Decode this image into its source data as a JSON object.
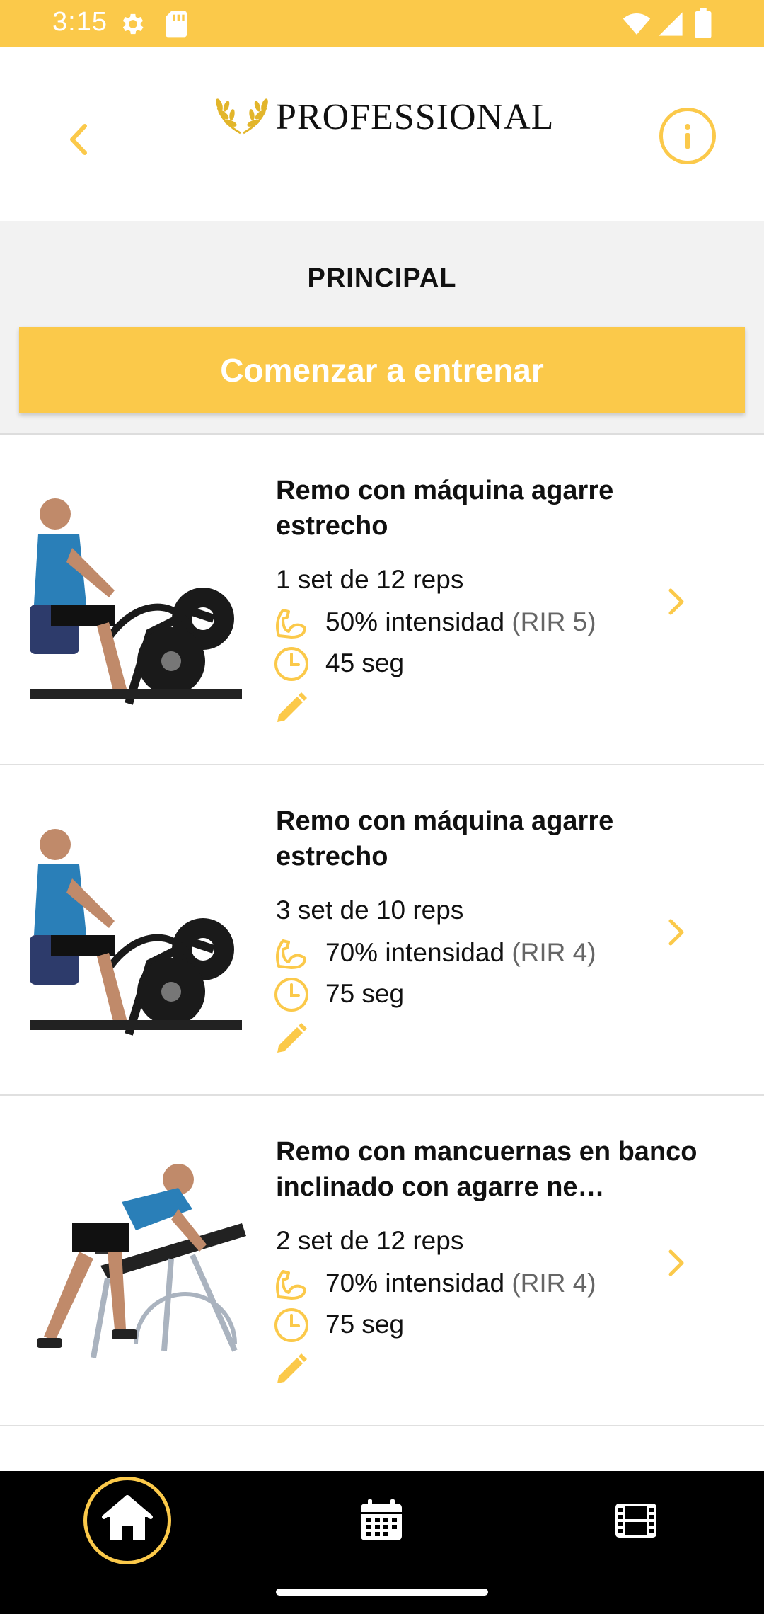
{
  "status_bar": {
    "time": "3:15",
    "background": "#FBC94A"
  },
  "header": {
    "logo_text": "PROFESSIONAL",
    "back_icon": "chevron-left-icon",
    "info_icon": "info-icon",
    "accent": "#FBC94A"
  },
  "section": {
    "title": "PRINCIPAL",
    "start_button": "Comenzar a entrenar"
  },
  "exercises": [
    {
      "title": "Remo con máquina agarre estrecho",
      "sets": "1 set de 12 reps",
      "intensity": "50% intensidad",
      "rir": "(RIR 5)",
      "rest": "45 seg"
    },
    {
      "title": "Remo con máquina agarre estrecho",
      "sets": "3 set de 10 reps",
      "intensity": "70% intensidad",
      "rir": "(RIR 4)",
      "rest": "75 seg"
    },
    {
      "title": "Remo con mancuernas en banco inclinado con agarre ne…",
      "sets": "2 set de 12 reps",
      "intensity": "70% intensidad",
      "rir": "(RIR 4)",
      "rest": "75 seg"
    }
  ],
  "bottom_nav": {
    "items": [
      "home-icon",
      "calendar-icon",
      "film-icon"
    ],
    "active": "home-icon"
  }
}
